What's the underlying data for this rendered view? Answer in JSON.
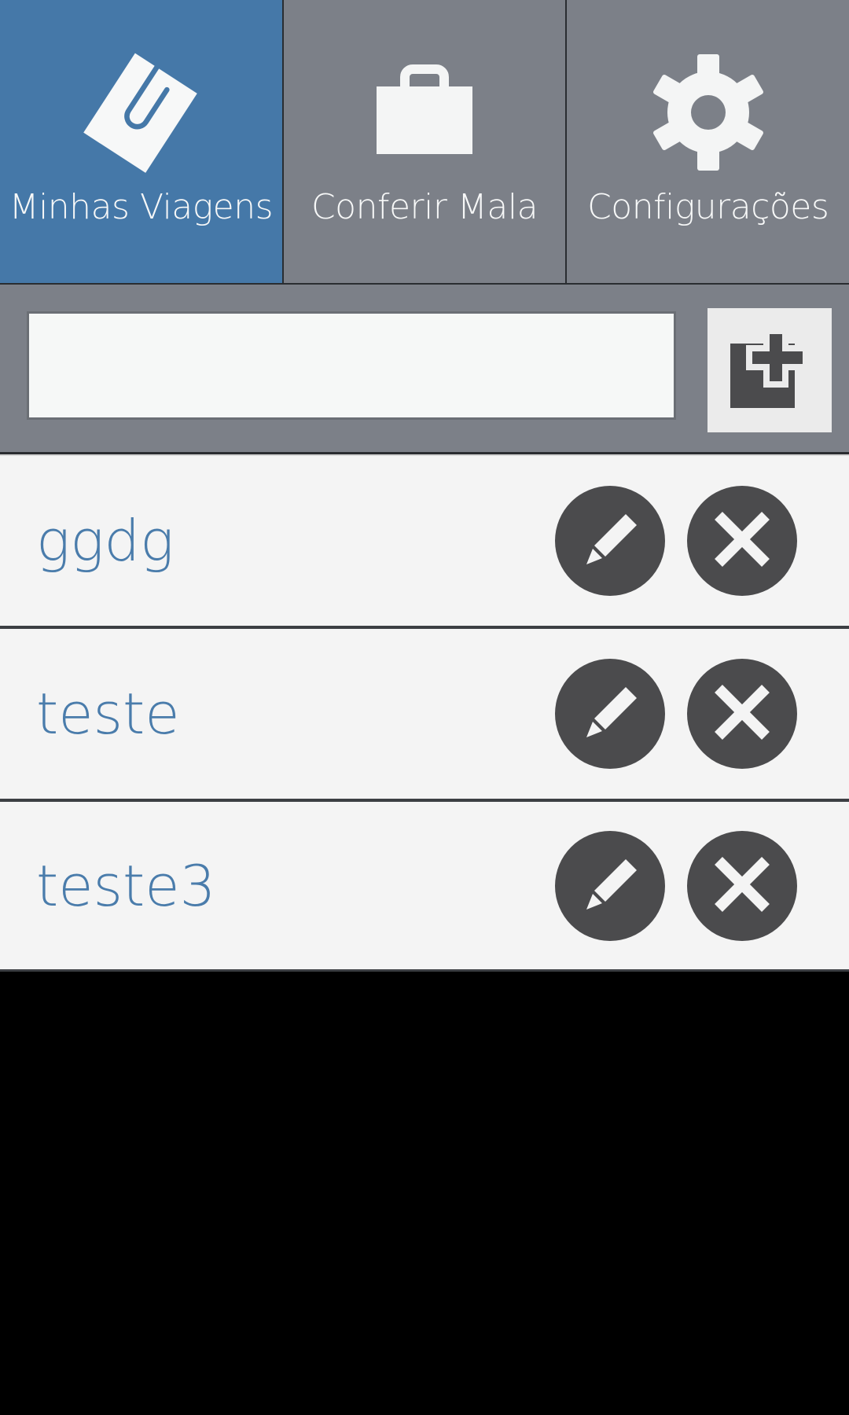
{
  "tabs": [
    {
      "label": "Minhas Viagens",
      "icon": "paperclip-note-icon",
      "active": true
    },
    {
      "label": "Conferir Mala",
      "icon": "suitcase-icon",
      "active": false
    },
    {
      "label": "Configurações",
      "icon": "gear-icon",
      "active": false
    }
  ],
  "add": {
    "input_value": "",
    "input_placeholder": "",
    "button_icon": "add-document-icon"
  },
  "trips": [
    {
      "name": "ggdg"
    },
    {
      "name": "teste"
    },
    {
      "name": "teste3"
    }
  ],
  "row_actions": {
    "edit_icon": "pencil-icon",
    "delete_icon": "close-icon"
  },
  "colors": {
    "accent": "#4578a8",
    "tab_bg": "#7c8088",
    "row_text": "#4a7cab",
    "action_circle": "#4b4b4d"
  }
}
